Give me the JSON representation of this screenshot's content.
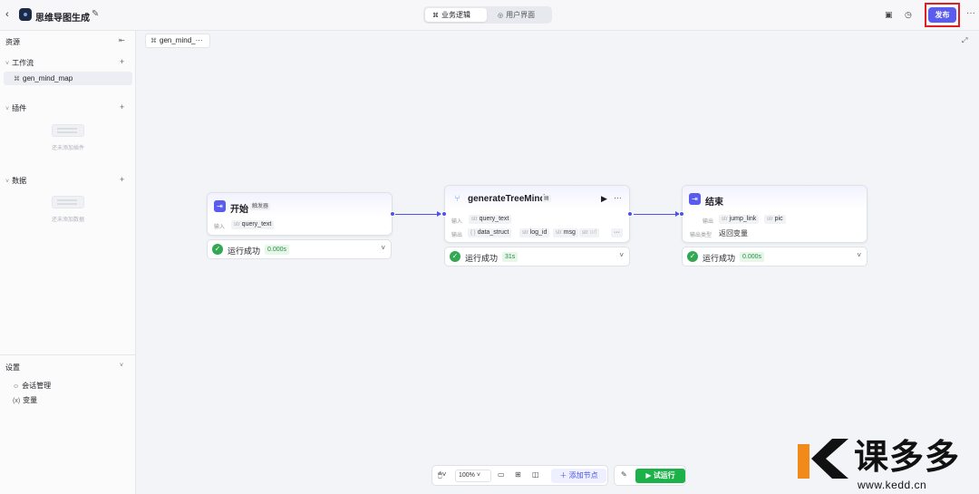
{
  "header": {
    "back_icon": "chevron-left-icon",
    "app_title": "思维导图生成",
    "tabs": [
      {
        "label": "业务逻辑",
        "icon": "flow-icon",
        "active": true
      },
      {
        "label": "用户界面",
        "icon": "ui-icon",
        "active": false
      }
    ],
    "publish_label": "发布",
    "accent_color": "#5a5cf0"
  },
  "sidebar": {
    "title": "资源",
    "sections": {
      "workflow": {
        "label": "工作流",
        "items": [
          "gen_mind_map"
        ]
      },
      "plugins": {
        "label": "插件",
        "empty_text": "还未添加插件"
      },
      "data": {
        "label": "数据",
        "empty_text": "还未添加数据"
      }
    },
    "settings": {
      "title": "设置",
      "items": [
        {
          "label": "会话管理",
          "icon": "chat-icon"
        },
        {
          "label": "变量",
          "icon": "(x)"
        }
      ]
    }
  },
  "canvas": {
    "tab_label": "gen_mind_···",
    "nodes": {
      "start": {
        "title": "开始",
        "tag": "触发器",
        "input_label": "输入",
        "inputs": [
          {
            "type": "str",
            "name": "query_text"
          }
        ],
        "status": "运行成功",
        "duration": "0.000s"
      },
      "llm": {
        "title": "generateTreeMind",
        "input_label": "输入",
        "inputs": [
          {
            "type": "str",
            "name": "query_text"
          }
        ],
        "output_label": "输出",
        "outputs": [
          {
            "type": "{ }",
            "name": "data_struct"
          },
          {
            "type": "str",
            "name": "log_id"
          },
          {
            "type": "str",
            "name": "msg"
          },
          {
            "type": "str",
            "name": "url"
          }
        ],
        "more": "···",
        "status": "运行成功",
        "duration": "31s"
      },
      "end": {
        "title": "结束",
        "output_label": "输出",
        "outputs": [
          {
            "type": "str",
            "name": "jump_link"
          },
          {
            "type": "str",
            "name": "pic"
          }
        ],
        "output_type_label": "输出类型",
        "output_type_value": "返回变量",
        "status": "运行成功",
        "duration": "0.000s"
      }
    }
  },
  "toolbar": {
    "zoom": "100%",
    "add_node_label": "添加节点",
    "run_label": "试运行",
    "run_color": "#1db149"
  },
  "watermark": {
    "text": "课多多",
    "url": "www.kedd.cn"
  }
}
